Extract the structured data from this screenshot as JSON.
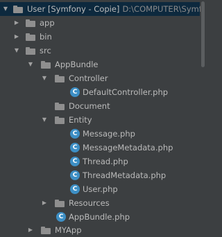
{
  "tree": {
    "root": {
      "label": "User [Symfony - Copie]",
      "path": "D:\\COMPUTER\\Symfon",
      "icon": "folder-icon",
      "expanded": true
    },
    "items": [
      {
        "label": "app",
        "icon": "folder-icon",
        "expanded": false
      },
      {
        "label": "bin",
        "icon": "folder-icon",
        "expanded": false
      },
      {
        "label": "src",
        "icon": "folder-icon",
        "expanded": true
      },
      {
        "label": "AppBundle",
        "icon": "folder-icon",
        "expanded": true
      },
      {
        "label": "Controller",
        "icon": "folder-icon",
        "expanded": true
      },
      {
        "label": "DefaultController.php",
        "icon": "php-class-icon",
        "badge": "C"
      },
      {
        "label": "Document",
        "icon": "folder-icon"
      },
      {
        "label": "Entity",
        "icon": "folder-icon",
        "expanded": true
      },
      {
        "label": "Message.php",
        "icon": "php-class-icon",
        "badge": "C"
      },
      {
        "label": "MessageMetadata.php",
        "icon": "php-class-icon",
        "badge": "C"
      },
      {
        "label": "Thread.php",
        "icon": "php-class-icon",
        "badge": "C"
      },
      {
        "label": "ThreadMetadata.php",
        "icon": "php-class-icon",
        "badge": "C"
      },
      {
        "label": "User.php",
        "icon": "php-class-icon",
        "badge": "C"
      },
      {
        "label": "Resources",
        "icon": "folder-icon",
        "expanded": false
      },
      {
        "label": "AppBundle.php",
        "icon": "php-class-icon",
        "badge": "C"
      },
      {
        "label": "MYApp",
        "icon": "folder-icon",
        "expanded": false
      }
    ],
    "arrow_expanded": "▼",
    "arrow_collapsed": "▶"
  },
  "colors": {
    "background": "#3c3f41",
    "selection": "#0d293e",
    "text": "#bbbbbb",
    "class_icon": "#3d8fc5",
    "folder_icon": "#8f8f8f"
  }
}
